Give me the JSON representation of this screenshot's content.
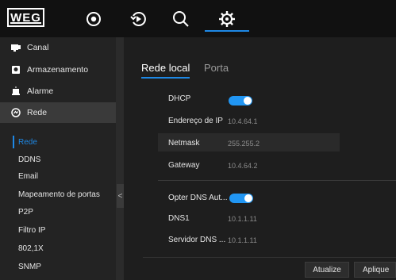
{
  "brand": {
    "logo_text": "WEG"
  },
  "topbar": {
    "icons": [
      "live-view-icon",
      "playback-icon",
      "search-icon",
      "settings-icon"
    ],
    "active": "settings-icon",
    "accent": "#1e88e5"
  },
  "sidebar": {
    "items": [
      {
        "label": "Canal",
        "icon": "channel-icon"
      },
      {
        "label": "Armazenamento",
        "icon": "storage-icon"
      },
      {
        "label": "Alarme",
        "icon": "alarm-icon"
      },
      {
        "label": "Rede",
        "icon": "network-icon"
      }
    ],
    "sub_items": [
      {
        "label": "Rede"
      },
      {
        "label": "DDNS"
      },
      {
        "label": "Email"
      },
      {
        "label": "Mapeamento de portas"
      },
      {
        "label": "P2P"
      },
      {
        "label": "Filtro IP"
      },
      {
        "label": "802,1X"
      },
      {
        "label": "SNMP"
      }
    ],
    "collapse_glyph": "<"
  },
  "tabs": [
    {
      "label": "Rede local"
    },
    {
      "label": "Porta"
    }
  ],
  "form": {
    "dhcp": {
      "label": "DHCP",
      "enabled": true
    },
    "ip": {
      "label": "Endereço de IP",
      "value": "10.4.64.1"
    },
    "netmask": {
      "label": "Netmask",
      "value": "255.255.2"
    },
    "gateway": {
      "label": "Gateway",
      "value": "10.4.64.2"
    },
    "auto_dns": {
      "label": "Opter DNS Aut...",
      "enabled": true
    },
    "dns1": {
      "label": "DNS1",
      "value": "10.1.1.11"
    },
    "dns2": {
      "label": "Servidor DNS ...",
      "value": "10.1.1.11"
    }
  },
  "buttons": {
    "update": "Atualize",
    "apply": "Aplique"
  }
}
